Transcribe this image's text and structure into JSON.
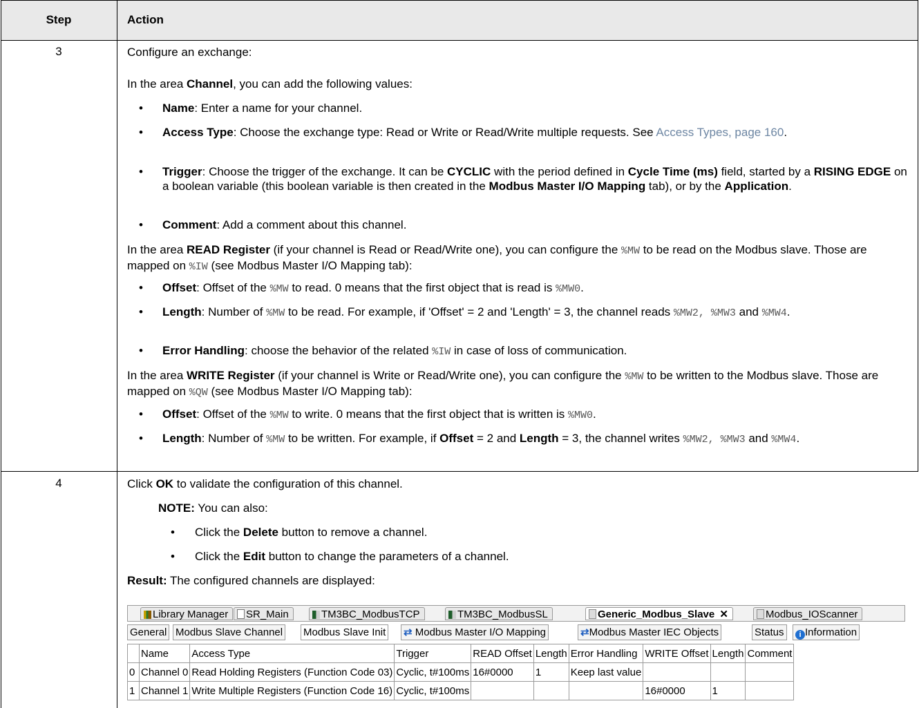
{
  "table": {
    "header": {
      "step": "Step",
      "action": "Action"
    },
    "rows": [
      {
        "step": "3",
        "intro": "Configure an exchange:",
        "channel_intro": {
          "pre": "In the area ",
          "bold": "Channel",
          "post": ", you can add the following values:"
        },
        "channel_items": [
          {
            "term": "Name",
            "text": ": Enter a name for your channel."
          },
          {
            "term": "Access Type",
            "text": ": Choose the exchange type: Read or Write or Read/Write multiple requests. See ",
            "link": "Access Types, page 160",
            "after": "."
          },
          {
            "term": "Trigger",
            "t1": ": Choose the trigger of the exchange. It can be ",
            "b1": "CYCLIC",
            "t2": " with the period defined in ",
            "b2": "Cycle Time (ms)",
            "t3": " field, started by a ",
            "b3": "RISING EDGE",
            "t4": " on a boolean variable (this boolean variable is then created in the ",
            "b4": "Modbus Master I/O Mapping",
            "t5": " tab), or by the ",
            "b5": "Application",
            "t6": "."
          },
          {
            "term": "Comment",
            "text": ": Add a comment about this channel."
          }
        ],
        "read_intro": {
          "pre": "In the area ",
          "bold": "READ Register",
          "mid": " (if your channel is Read or Read/Write one), you can configure the ",
          "code1": "%MW",
          "mid2": " to be read on the Modbus slave. Those are mapped on ",
          "code2": "%IW",
          "post": " (see Modbus Master I/O Mapping tab):"
        },
        "read_items": [
          {
            "term": "Offset",
            "t1": ": Offset of the ",
            "c1": "%MW",
            "t2": " to read. 0 means that the first object that is read is ",
            "c2": "%MW0",
            "t3": "."
          },
          {
            "term": "Length",
            "t1": ": Number of ",
            "c1": "%MW",
            "t2": " to be read. For example, if 'Offset' = 2 and 'Length' = 3, the channel reads ",
            "c2": "%MW2, %MW3",
            "t3": " and ",
            "c3": "%MW4",
            "t4": "."
          },
          {
            "term": "Error Handling",
            "t1": ": choose the behavior of the related ",
            "c1": "%IW",
            "t2": " in case of loss of communication."
          }
        ],
        "write_intro": {
          "pre": "In the area ",
          "bold": "WRITE Register",
          "mid": " (if your channel is Write or Read/Write one), you can configure the ",
          "code1": "%MW",
          "mid2": " to be written to the Modbus slave. Those are mapped on ",
          "code2": "%QW",
          "post": " (see Modbus Master I/O Mapping tab):"
        },
        "write_items": [
          {
            "term": "Offset",
            "t1": ": Offset of the ",
            "c1": "%MW",
            "t2": " to write. 0 means that the first object that is written is ",
            "c2": "%MW0",
            "t3": "."
          },
          {
            "term": "Length",
            "t1": ": Number of ",
            "c1": "%MW",
            "t2": " to be written. For example, if ",
            "b1": "Offset",
            "t3": " = 2 and ",
            "b2": "Length",
            "t4": " = 3, the channel writes ",
            "c2": "%MW2, %MW3",
            "t5": " and ",
            "c3": "%MW4",
            "t6": "."
          }
        ]
      },
      {
        "step": "4",
        "click_ok": {
          "pre": "Click ",
          "bold": "OK",
          "post": " to validate the configuration of this channel."
        },
        "note": {
          "label": "NOTE:",
          "text": " You can also:"
        },
        "note_items": [
          {
            "pre": "Click the ",
            "bold": "Delete",
            "post": " button to remove a channel."
          },
          {
            "pre": "Click the ",
            "bold": "Edit",
            "post": " button to change the parameters of a channel."
          }
        ],
        "result": {
          "label": "Result:",
          "text": " The configured channels are displayed:"
        }
      }
    ]
  },
  "screenshot": {
    "tabs": [
      "Library Manager",
      "SR_Main",
      "TM3BC_ModbusTCP",
      "TM3BC_ModbusSL",
      "Generic_Modbus_Slave",
      "Modbus_IOScanner"
    ],
    "active_tab": "Generic_Modbus_Slave",
    "close_glyph": "✕",
    "subtabs": [
      "General",
      "Modbus Slave Channel",
      "Modbus Slave Init",
      "Modbus Master I/O Mapping",
      "Modbus Master IEC Objects",
      "Status",
      "Information"
    ],
    "columns": [
      "",
      "Name",
      "Access Type",
      "Trigger",
      "READ Offset",
      "Length",
      "Error Handling",
      "WRITE Offset",
      "Length",
      "Comment"
    ],
    "rows": [
      [
        "0",
        "Channel 0",
        "Read Holding Registers (Function Code 03)",
        "Cyclic, t#100ms",
        "16#0000",
        "1",
        "Keep last value",
        "",
        "",
        ""
      ],
      [
        "1",
        "Channel 1",
        "Write Multiple Registers (Function Code 16)",
        "Cyclic, t#100ms",
        "",
        "",
        "",
        "16#0000",
        "1",
        ""
      ]
    ]
  },
  "colors": {
    "header_bg": "#e9e9e9",
    "link": "#6d86a3",
    "info_icon": "#1f6fd1"
  }
}
